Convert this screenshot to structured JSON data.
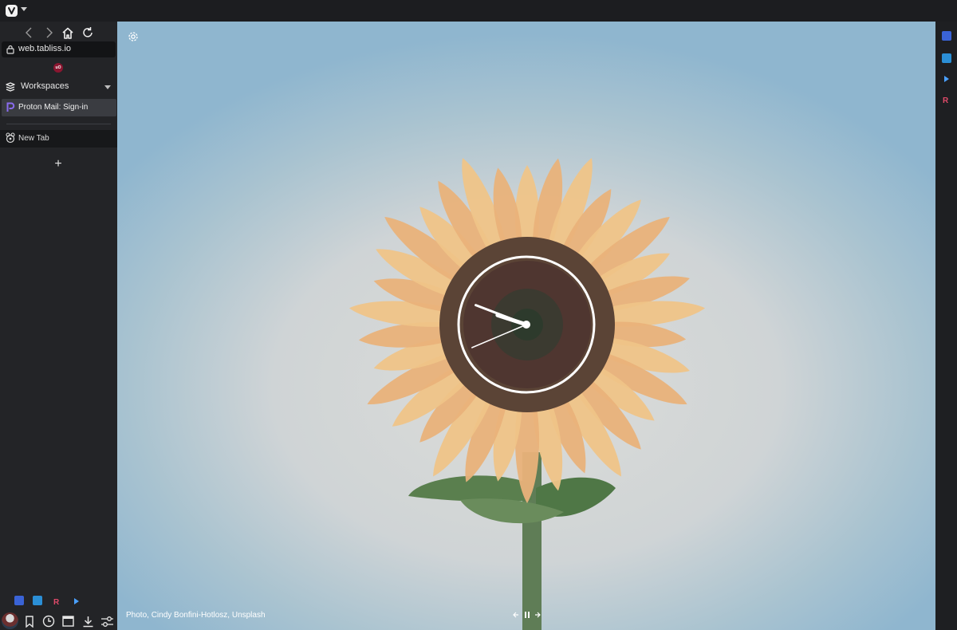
{
  "browser": {
    "address": "web.tabliss.io",
    "workspaces_label": "Workspaces",
    "tabs": [
      {
        "title": "Proton Mail: Sign-in",
        "icon": "proton-icon",
        "active": true
      },
      {
        "title": "New Tab",
        "icon": "tabliss-icon",
        "active": false
      }
    ],
    "new_tab_label": "+",
    "extensions_badge": "uO"
  },
  "tabliss": {
    "credit": "Photo, Cindy Bonfini-Hotlosz, Unsplash",
    "clock": {
      "type": "analog",
      "hour_hand_angle_deg": -72,
      "minute_hand_angle_deg": -69,
      "second_hand_angle_deg": -113
    }
  },
  "colors": {
    "sidebar_bg": "#232427",
    "active_tab_bg": "#3a3c41",
    "sky_top": "#8fb6cf",
    "sky_center": "#dcdcd8"
  }
}
